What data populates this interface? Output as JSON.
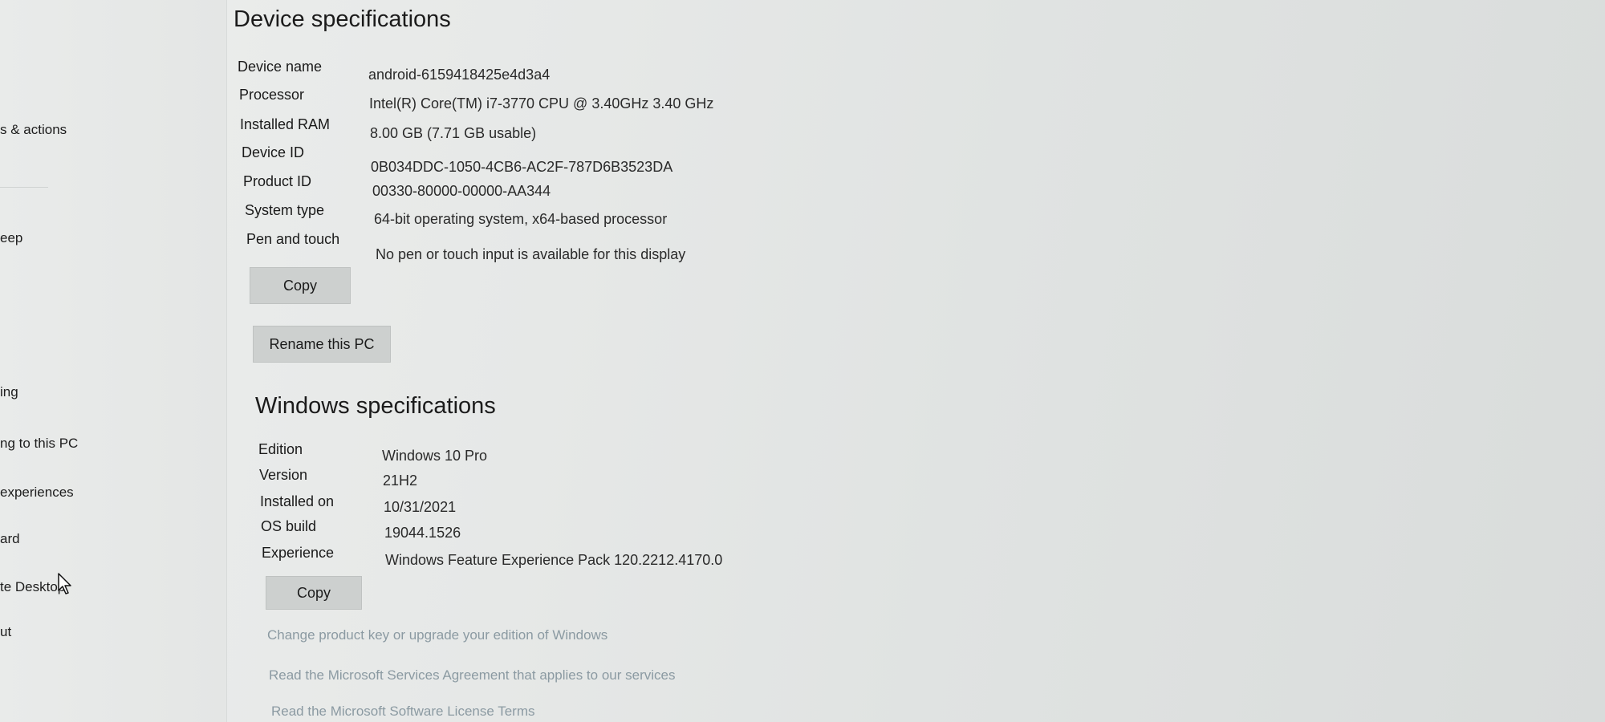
{
  "sidebar": {
    "items": [
      {
        "label": "s & actions"
      },
      {
        "label": "eep"
      },
      {
        "label": "ing"
      },
      {
        "label": "ng to this PC"
      },
      {
        "label": "experiences"
      },
      {
        "label": "ard"
      },
      {
        "label": "te Desktop"
      },
      {
        "label": "ut"
      }
    ]
  },
  "device_specs": {
    "title": "Device specifications",
    "rows": [
      {
        "label": "Device name",
        "value": "android-6159418425e4d3a4"
      },
      {
        "label": "Processor",
        "value": "Intel(R) Core(TM) i7-3770 CPU @ 3.40GHz   3.40 GHz"
      },
      {
        "label": "Installed RAM",
        "value": "8.00 GB (7.71 GB usable)"
      },
      {
        "label": "Device ID",
        "value": "0B034DDC-1050-4CB6-AC2F-787D6B3523DA"
      },
      {
        "label": "Product ID",
        "value": "00330-80000-00000-AA344"
      },
      {
        "label": "System type",
        "value": "64-bit operating system, x64-based processor"
      },
      {
        "label": "Pen and touch",
        "value": "No pen or touch input is available for this display"
      }
    ],
    "copy_label": "Copy",
    "rename_label": "Rename this PC"
  },
  "windows_specs": {
    "title": "Windows specifications",
    "rows": [
      {
        "label": "Edition",
        "value": "Windows 10 Pro"
      },
      {
        "label": "Version",
        "value": "21H2"
      },
      {
        "label": "Installed on",
        "value": "10/31/2021"
      },
      {
        "label": "OS build",
        "value": "19044.1526"
      },
      {
        "label": "Experience",
        "value": "Windows Feature Experience Pack 120.2212.4170.0"
      }
    ],
    "copy_label": "Copy"
  },
  "links": [
    {
      "label": "Change product key or upgrade your edition of Windows"
    },
    {
      "label": "Read the Microsoft Services Agreement that applies to our services"
    },
    {
      "label": "Read the Microsoft Software License Terms"
    }
  ],
  "icons": {
    "cursor": "mouse-pointer-icon"
  }
}
